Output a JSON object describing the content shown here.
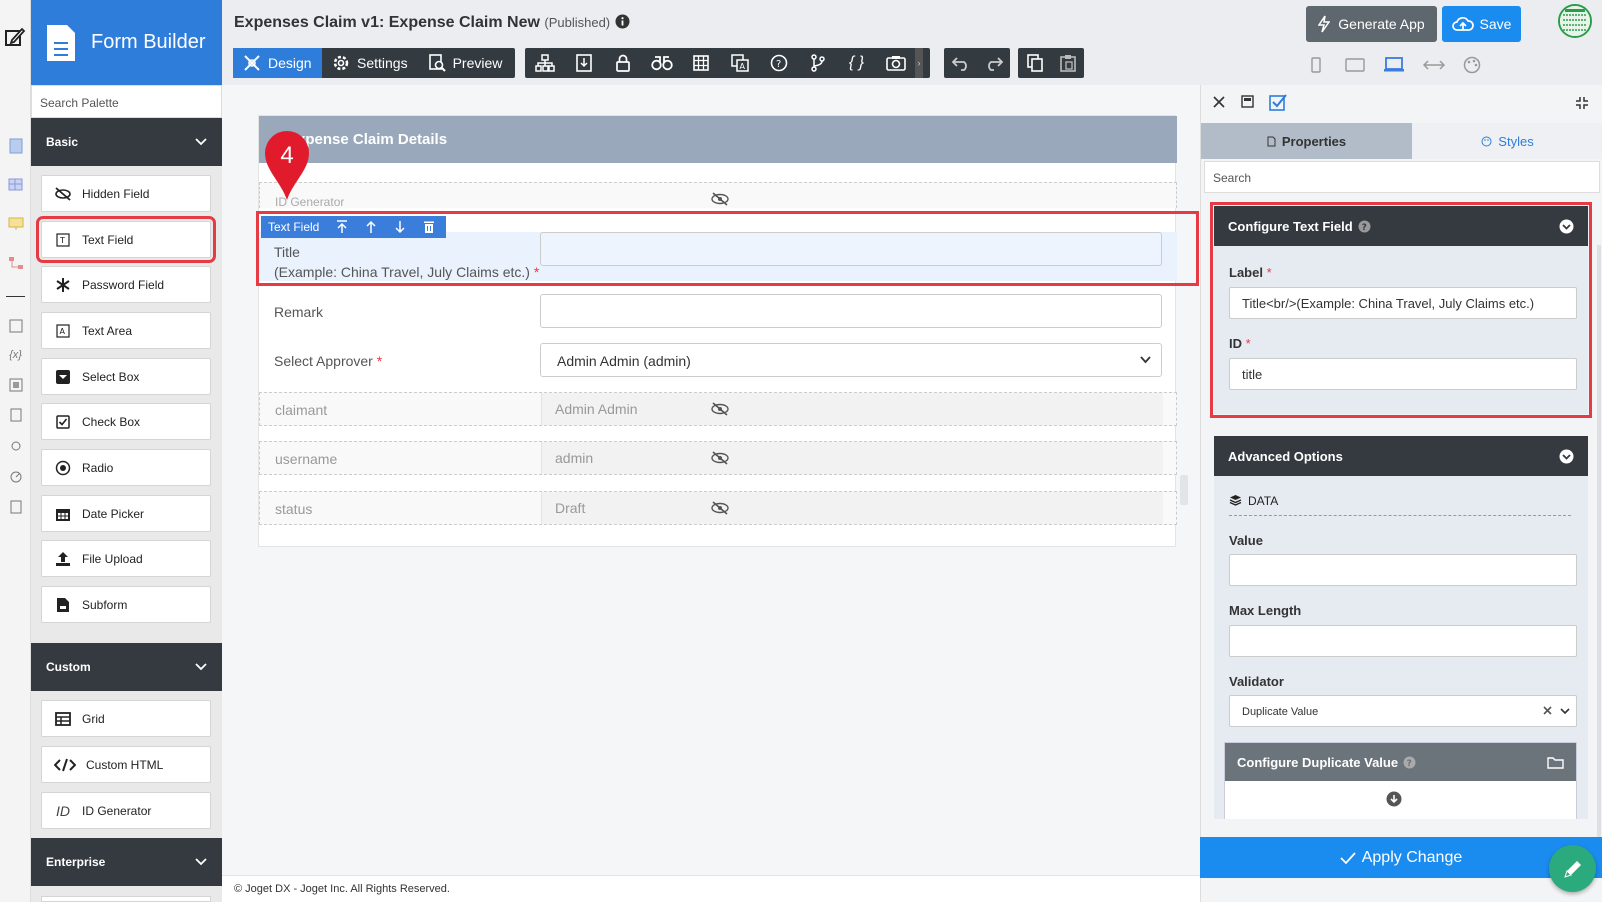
{
  "app": {
    "builder_title": "Form Builder",
    "form_title": "Expenses Claim v1: Expense Claim New",
    "status": "(Published)"
  },
  "palette": {
    "search_placeholder": "Search Palette",
    "categories": [
      {
        "name": "Basic",
        "items": [
          "Hidden Field",
          "Text Field",
          "Password Field",
          "Text Area",
          "Select Box",
          "Check Box",
          "Radio",
          "Date Picker",
          "File Upload",
          "Subform"
        ]
      },
      {
        "name": "Custom",
        "items": [
          "Grid",
          "Custom HTML",
          "ID Generator"
        ]
      },
      {
        "name": "Enterprise",
        "items": []
      }
    ]
  },
  "toolbar": {
    "tabs": [
      "Design",
      "Settings",
      "Preview"
    ],
    "active_tab": "Design",
    "generate_label": "Generate App",
    "save_label": "Save"
  },
  "form": {
    "section_title": "Expense Claim Details",
    "id_generator_label": "ID Generator",
    "selected_tool_label": "Text Field",
    "title_label_line1": "Title",
    "title_label_line2": "(Example: China Travel, July Claims etc.)",
    "remark_label": "Remark",
    "approver_label": "Select Approver",
    "approver_value": "Admin Admin (admin)",
    "hidden_rows": [
      {
        "label": "claimant",
        "value": "Admin Admin"
      },
      {
        "label": "username",
        "value": "admin"
      },
      {
        "label": "status",
        "value": "Draft"
      }
    ],
    "step_marker": "4"
  },
  "properties": {
    "tab_properties": "Properties",
    "tab_styles": "Styles",
    "search_placeholder": "Search",
    "configure_title": "Configure Text Field",
    "label_caption": "Label",
    "label_value": "Title<br/>(Example: China Travel, July Claims etc.)",
    "id_caption": "ID",
    "id_value": "title",
    "advanced_title": "Advanced Options",
    "data_heading": "DATA",
    "value_caption": "Value",
    "value_value": "",
    "maxlen_caption": "Max Length",
    "maxlen_value": "",
    "validator_caption": "Validator",
    "validator_value": "Duplicate Value",
    "dup_title": "Configure Duplicate Value",
    "apply_label": "Apply Change"
  },
  "footer": {
    "text": "© Joget DX - Joget Inc. All Rights Reserved."
  },
  "colors": {
    "accent": "#2f7ddb",
    "dark": "#343a40",
    "highlight": "#e63b45",
    "apply": "#1a8cf0"
  }
}
